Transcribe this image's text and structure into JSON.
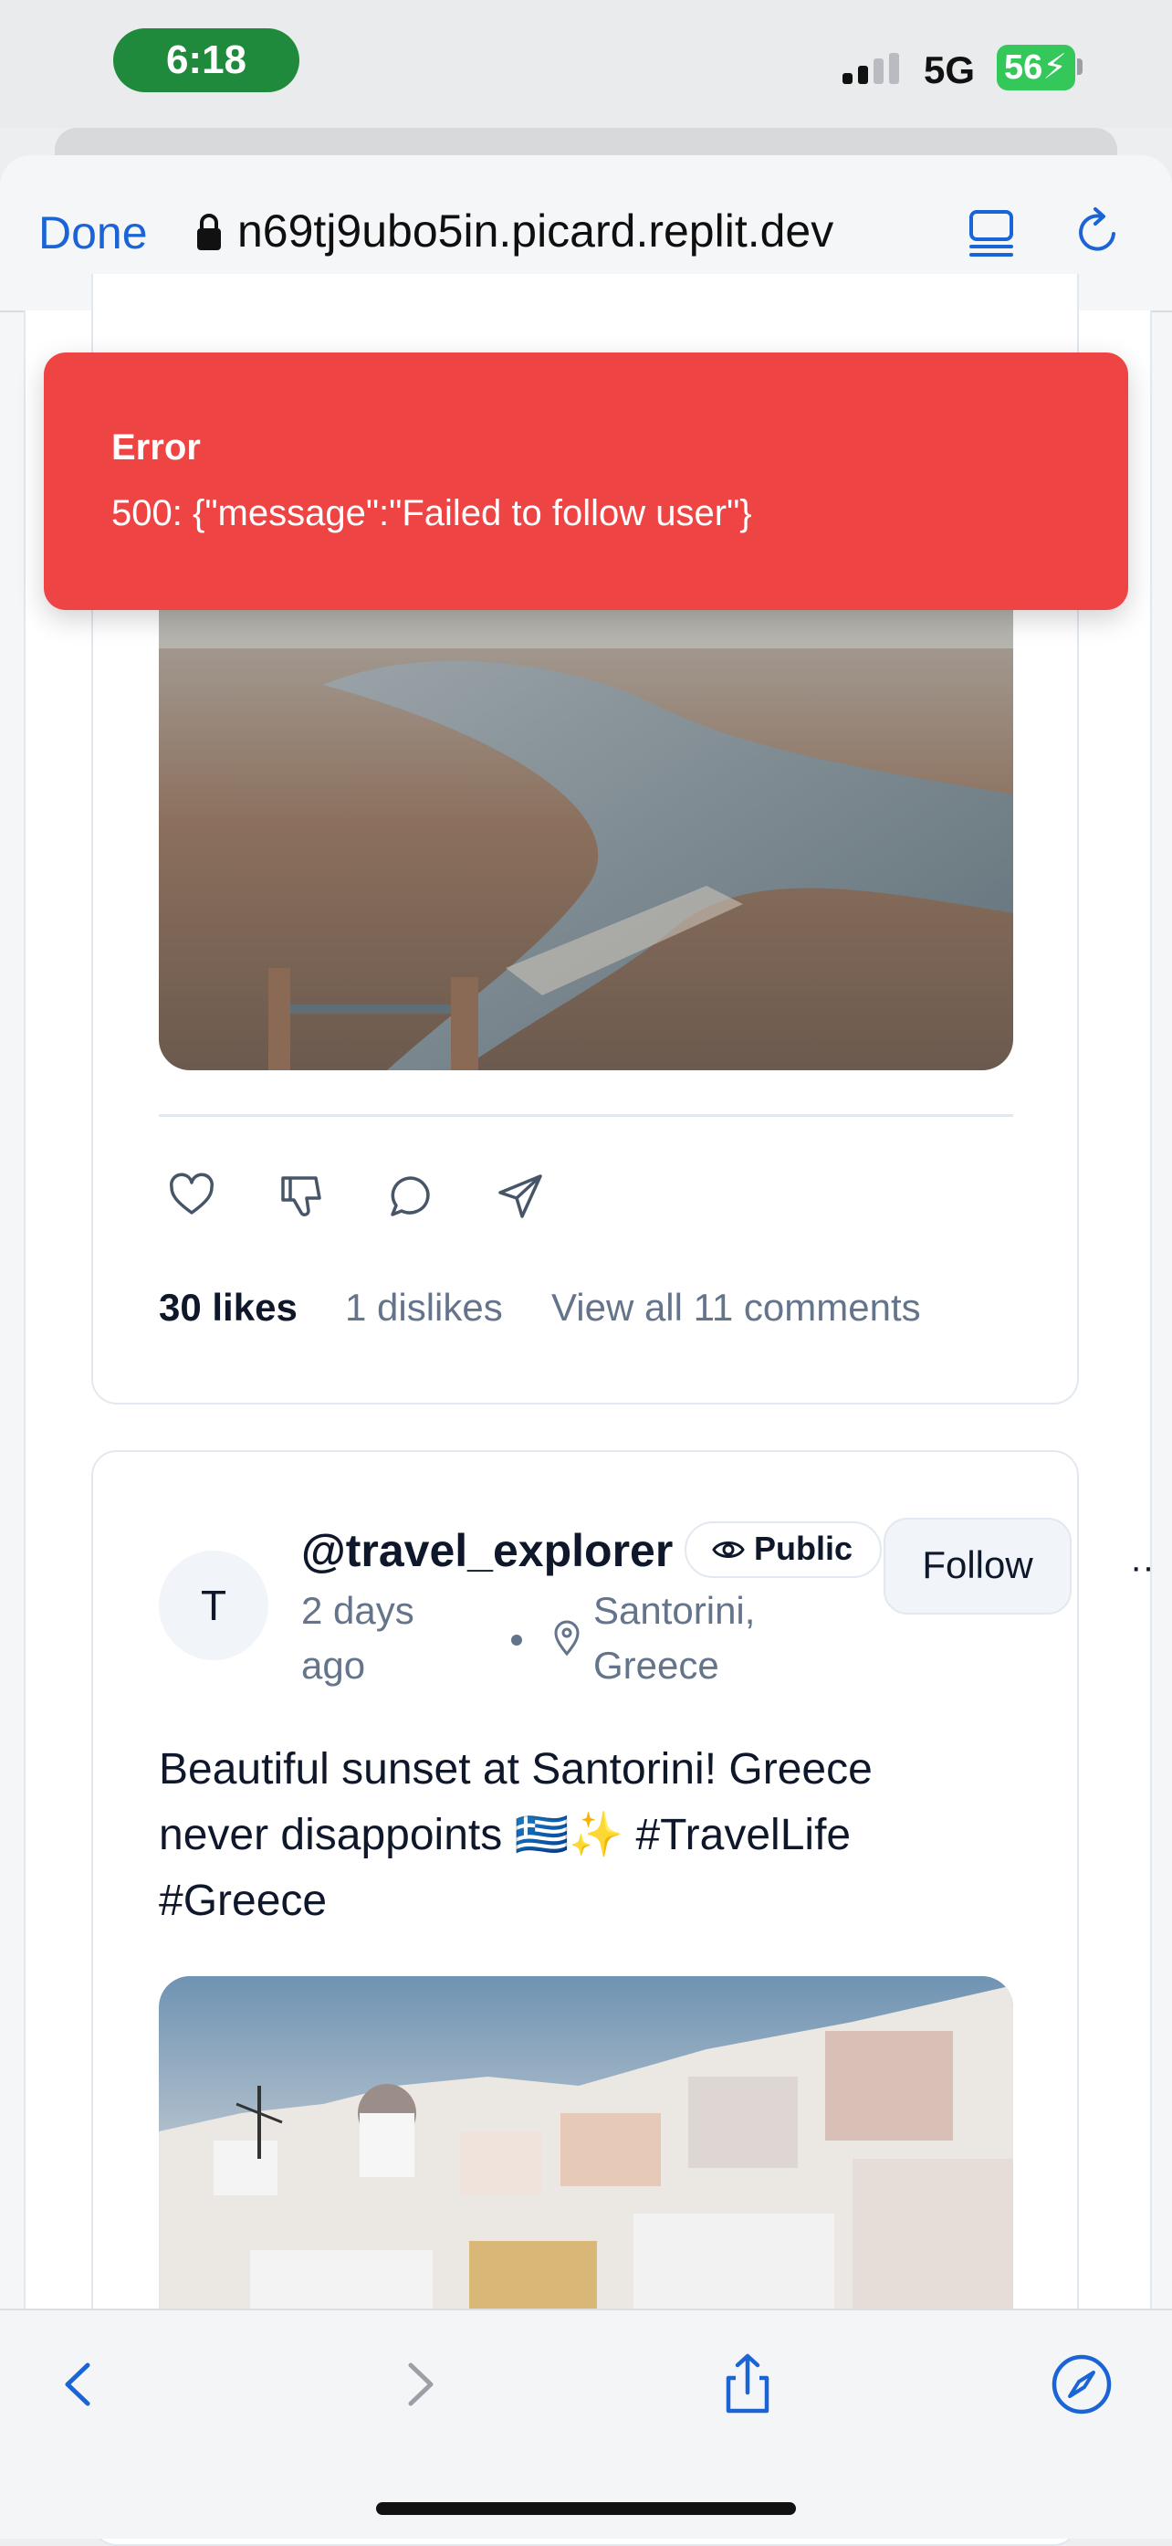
{
  "status_bar": {
    "time": "6:18",
    "network": "5G",
    "battery": "56"
  },
  "browser": {
    "done_label": "Done",
    "url": "n69tj9ubo5in.picard.replit.dev",
    "icons": [
      "lock-icon",
      "reader-icon",
      "reload-icon",
      "back-icon",
      "forward-icon",
      "share-icon",
      "compass-icon"
    ]
  },
  "toast": {
    "title": "Error",
    "message": "500: {\"message\":\"Failed to follow user\"}",
    "color": "#ef4444"
  },
  "post1": {
    "likes": "30 likes",
    "dislikes": "1 dislikes",
    "comments_link": "View all 11 comments",
    "actions": [
      "heart-icon",
      "thumbs-down-icon",
      "comment-icon",
      "send-icon"
    ]
  },
  "post2": {
    "avatar_initial": "T",
    "username": "@travel_explorer",
    "visibility": "Public",
    "follow_label": "Follow",
    "time_ago": "2 days ago",
    "location": "Santorini, Greece",
    "text": "Beautiful sunset at Santorini! Greece never disappoints 🇬🇷✨ #TravelLife #Greece"
  },
  "colors": {
    "accent": "#1a64d6",
    "error": "#ef4444",
    "muted_text": "#64748b",
    "border": "#e2e8f0"
  }
}
